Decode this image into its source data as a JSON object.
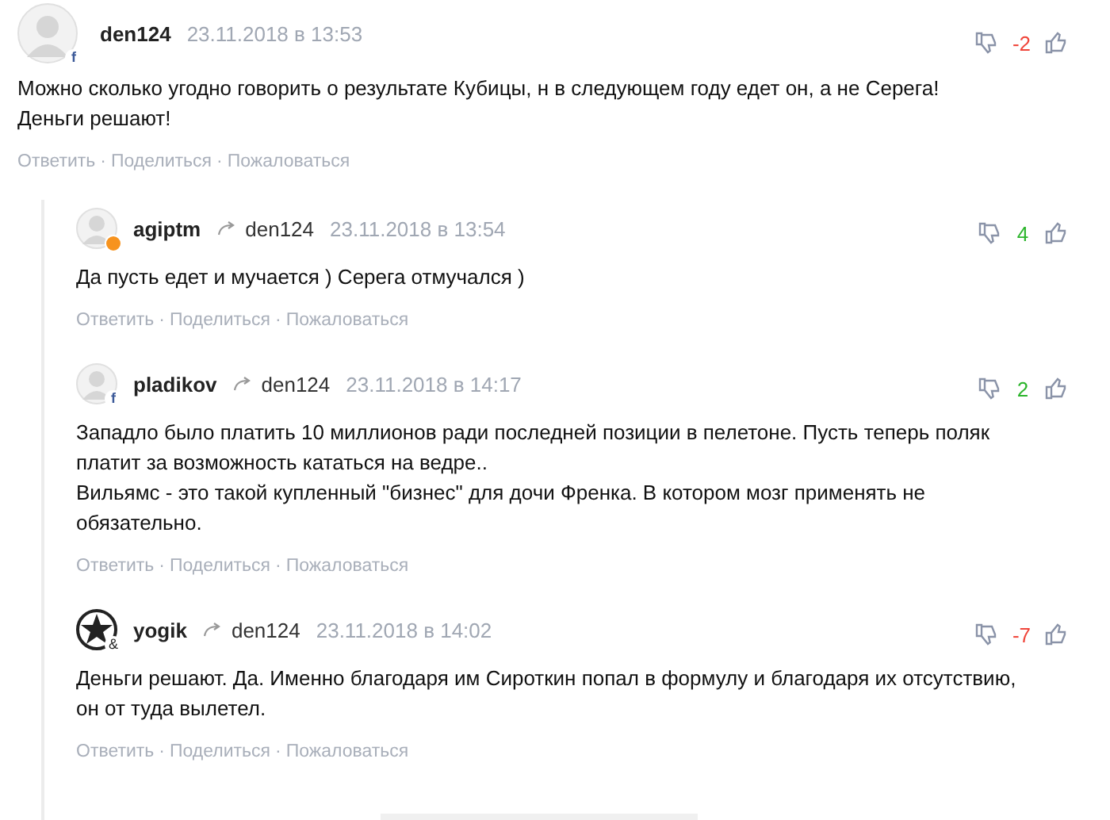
{
  "comment": {
    "author": "den124",
    "date": "23.11.2018 в 13:53",
    "avatar": {
      "kind": "facebook",
      "badge_text": "f"
    },
    "score": {
      "text": "-2",
      "color": "#f0453a"
    },
    "separator": "·",
    "lines": [
      "Можно сколько угодно говорить о результате Кубицы, н в следующем году едет он, а не Серега!",
      "Деньги решают!"
    ],
    "actions": [
      "Ответить",
      "Поделиться",
      "Пожаловаться"
    ]
  },
  "replies": [
    {
      "author": "agiptm",
      "reply_to": "den124",
      "date": "23.11.2018 в 13:54",
      "avatar": {
        "kind": "ok"
      },
      "score": {
        "text": "4",
        "color": "#2cb52c"
      },
      "separator": "·",
      "lines": [
        "Да пусть едет и мучается ) Серега отмучался )"
      ],
      "actions": [
        "Ответить",
        "Поделиться",
        "Пожаловаться"
      ]
    },
    {
      "author": "pladikov",
      "reply_to": "den124",
      "date": "23.11.2018 в 14:17",
      "avatar": {
        "kind": "facebook",
        "badge_text": "f"
      },
      "score": {
        "text": "2",
        "color": "#2cb52c"
      },
      "separator": "·",
      "lines": [
        "Западло было платить 10 миллионов ради последней позиции в пелетоне. Пусть теперь поляк",
        "платит за возможность кататься на ведре..",
        "Вильямс - это такой купленный \"бизнес\" для дочи Френка. В котором мозг применять не",
        "обязательно."
      ],
      "actions": [
        "Ответить",
        "Поделиться",
        "Пожаловаться"
      ]
    },
    {
      "author": "yogik",
      "reply_to": "den124",
      "date": "23.11.2018 в 14:02",
      "avatar": {
        "kind": "star",
        "badge_text": "&"
      },
      "score": {
        "text": "-7",
        "color": "#f0453a"
      },
      "separator": "·",
      "lines": [
        "Деньги решают. Да. Именно благодаря им Сироткин попал в формулу и благодаря их отсутствию,",
        "он от туда вылетел."
      ],
      "actions": [
        "Ответить",
        "Поделиться",
        "Пожаловаться"
      ]
    }
  ]
}
